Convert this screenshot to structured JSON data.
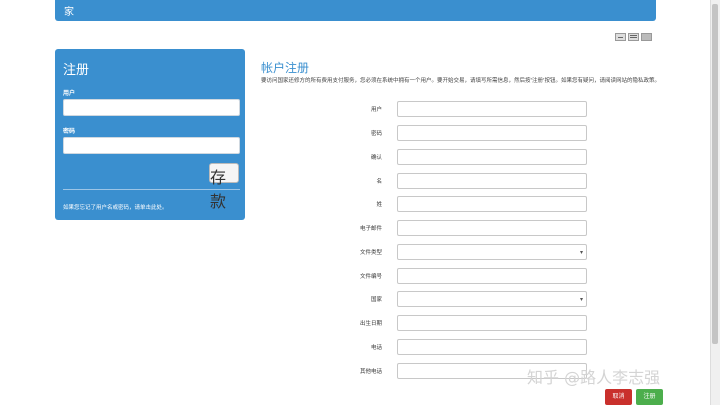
{
  "topbar": {
    "title": "家"
  },
  "login": {
    "heading": "注册",
    "user_label": "用户",
    "password_label": "密码",
    "save_button": "存款",
    "forgot_text": "如果您忘记了用户名或密码，请单击此处。"
  },
  "register": {
    "title": "帐户注册",
    "intro": "要访问国家还修方的所有费用支付服务，您必须在系统中拥有一个用户。要开始交易，请填写所需信息，然后按'注册'按钮。如果您有疑问，请阅读网站的隐私政策。",
    "fields": [
      {
        "label": "用户"
      },
      {
        "label": "密码"
      },
      {
        "label": "确认"
      },
      {
        "label": "名"
      },
      {
        "label": "姓"
      },
      {
        "label": "电子邮件"
      },
      {
        "label": "文件类型"
      },
      {
        "label": "文件编号"
      },
      {
        "label": "国家"
      },
      {
        "label": "出生日期"
      },
      {
        "label": "电话"
      },
      {
        "label": "其他电话"
      }
    ],
    "cancel_button": "取消",
    "register_button": "注册"
  },
  "watermark": "知乎 @路人李志强",
  "colors": {
    "primary": "#3a8fcf",
    "danger": "#c9302c",
    "success": "#4cae4c"
  }
}
